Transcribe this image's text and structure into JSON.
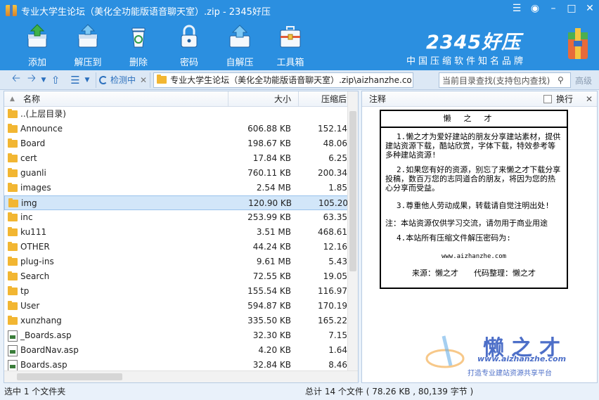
{
  "window": {
    "title": "专业大学生论坛（美化全功能版语音聊天室）.zip - 2345好压",
    "controls": [
      "menu-icon",
      "skin-icon",
      "minimize-icon",
      "maximize-icon",
      "close-icon"
    ]
  },
  "toolbar": {
    "buttons": [
      {
        "label": "添加",
        "icon": "add-archive-icon"
      },
      {
        "label": "解压到",
        "icon": "extract-icon"
      },
      {
        "label": "删除",
        "icon": "delete-icon"
      },
      {
        "label": "密码",
        "icon": "password-lock-icon"
      },
      {
        "label": "自解压",
        "icon": "self-extract-icon"
      },
      {
        "label": "工具箱",
        "icon": "toolbox-icon"
      }
    ],
    "brand": {
      "logo": "2345好压",
      "slogan": "中国压缩软件知名品牌"
    }
  },
  "address_bar": {
    "scan_label": "检测中",
    "path": "专业大学生论坛（美化全功能版语音聊天室）.zip\\aizhanzhe.co",
    "search_placeholder": "当前目录查找(支持包内查找)",
    "advanced_label": "高级"
  },
  "file_list": {
    "columns": {
      "name": "名称",
      "size": "大小",
      "compressed": "压缩后"
    },
    "rows": [
      {
        "name": "..(上层目录)",
        "size": "",
        "compressed": "",
        "type": "folder"
      },
      {
        "name": "Announce",
        "size": "606.88 KB",
        "compressed": "152.14",
        "type": "folder"
      },
      {
        "name": "Board",
        "size": "198.67 KB",
        "compressed": "48.06",
        "type": "folder"
      },
      {
        "name": "cert",
        "size": "17.84 KB",
        "compressed": "6.25",
        "type": "folder"
      },
      {
        "name": "guanli",
        "size": "760.11 KB",
        "compressed": "200.34",
        "type": "folder"
      },
      {
        "name": "images",
        "size": "2.54 MB",
        "compressed": "1.85",
        "type": "folder"
      },
      {
        "name": "img",
        "size": "120.90 KB",
        "compressed": "105.20",
        "type": "folder",
        "selected": true
      },
      {
        "name": "inc",
        "size": "253.99 KB",
        "compressed": "63.35",
        "type": "folder"
      },
      {
        "name": "ku111",
        "size": "3.51 MB",
        "compressed": "468.61",
        "type": "folder"
      },
      {
        "name": "OTHER",
        "size": "44.24 KB",
        "compressed": "12.16",
        "type": "folder"
      },
      {
        "name": "plug-ins",
        "size": "9.61 MB",
        "compressed": "5.43",
        "type": "folder"
      },
      {
        "name": "Search",
        "size": "72.55 KB",
        "compressed": "19.05",
        "type": "folder"
      },
      {
        "name": "tp",
        "size": "155.54 KB",
        "compressed": "116.97",
        "type": "folder"
      },
      {
        "name": "User",
        "size": "594.87 KB",
        "compressed": "170.19",
        "type": "folder"
      },
      {
        "name": "xunzhang",
        "size": "335.50 KB",
        "compressed": "165.22",
        "type": "folder"
      },
      {
        "name": "_Boards.asp",
        "size": "32.30 KB",
        "compressed": "7.15",
        "type": "file"
      },
      {
        "name": "BoardNav.asp",
        "size": "4.20 KB",
        "compressed": "1.64",
        "type": "file"
      },
      {
        "name": "Boards.asp",
        "size": "32.84 KB",
        "compressed": "8.46",
        "type": "file"
      }
    ]
  },
  "comment_pane": {
    "header": "注释",
    "wrap_label": "换行",
    "notice": {
      "title": "懒之才",
      "lines": [
        "1.懒之才为爱好建站的朋友分享建站素材，提供建站资源下载，酷站欣赏，字体下载，特效参考等多种建站资源!",
        "2.如果您有好的资源，别忘了来懒之才下载分享投稿，数百万您的志同道合的朋友，将因为您的热心分享而受益。",
        "3.尊重他人劳动成果，转载请自觉注明出处!",
        "注：本站资源仅供学习交流，请勿用于商业用途",
        "4.本站所有压缩文件解压密码为:",
        "www.aizhanzhe.com",
        "来源：懒之才　　代码整理：懒之才"
      ]
    },
    "watermark": {
      "big": "懒之才",
      "url": "www.aizhanzhe.com",
      "sub": "打造专业建站资源共享平台"
    }
  },
  "status": {
    "left": "选中 1 个文件夹",
    "right": "总计 14 个文件 ( 78.26 KB , 80,139 字节 )"
  }
}
